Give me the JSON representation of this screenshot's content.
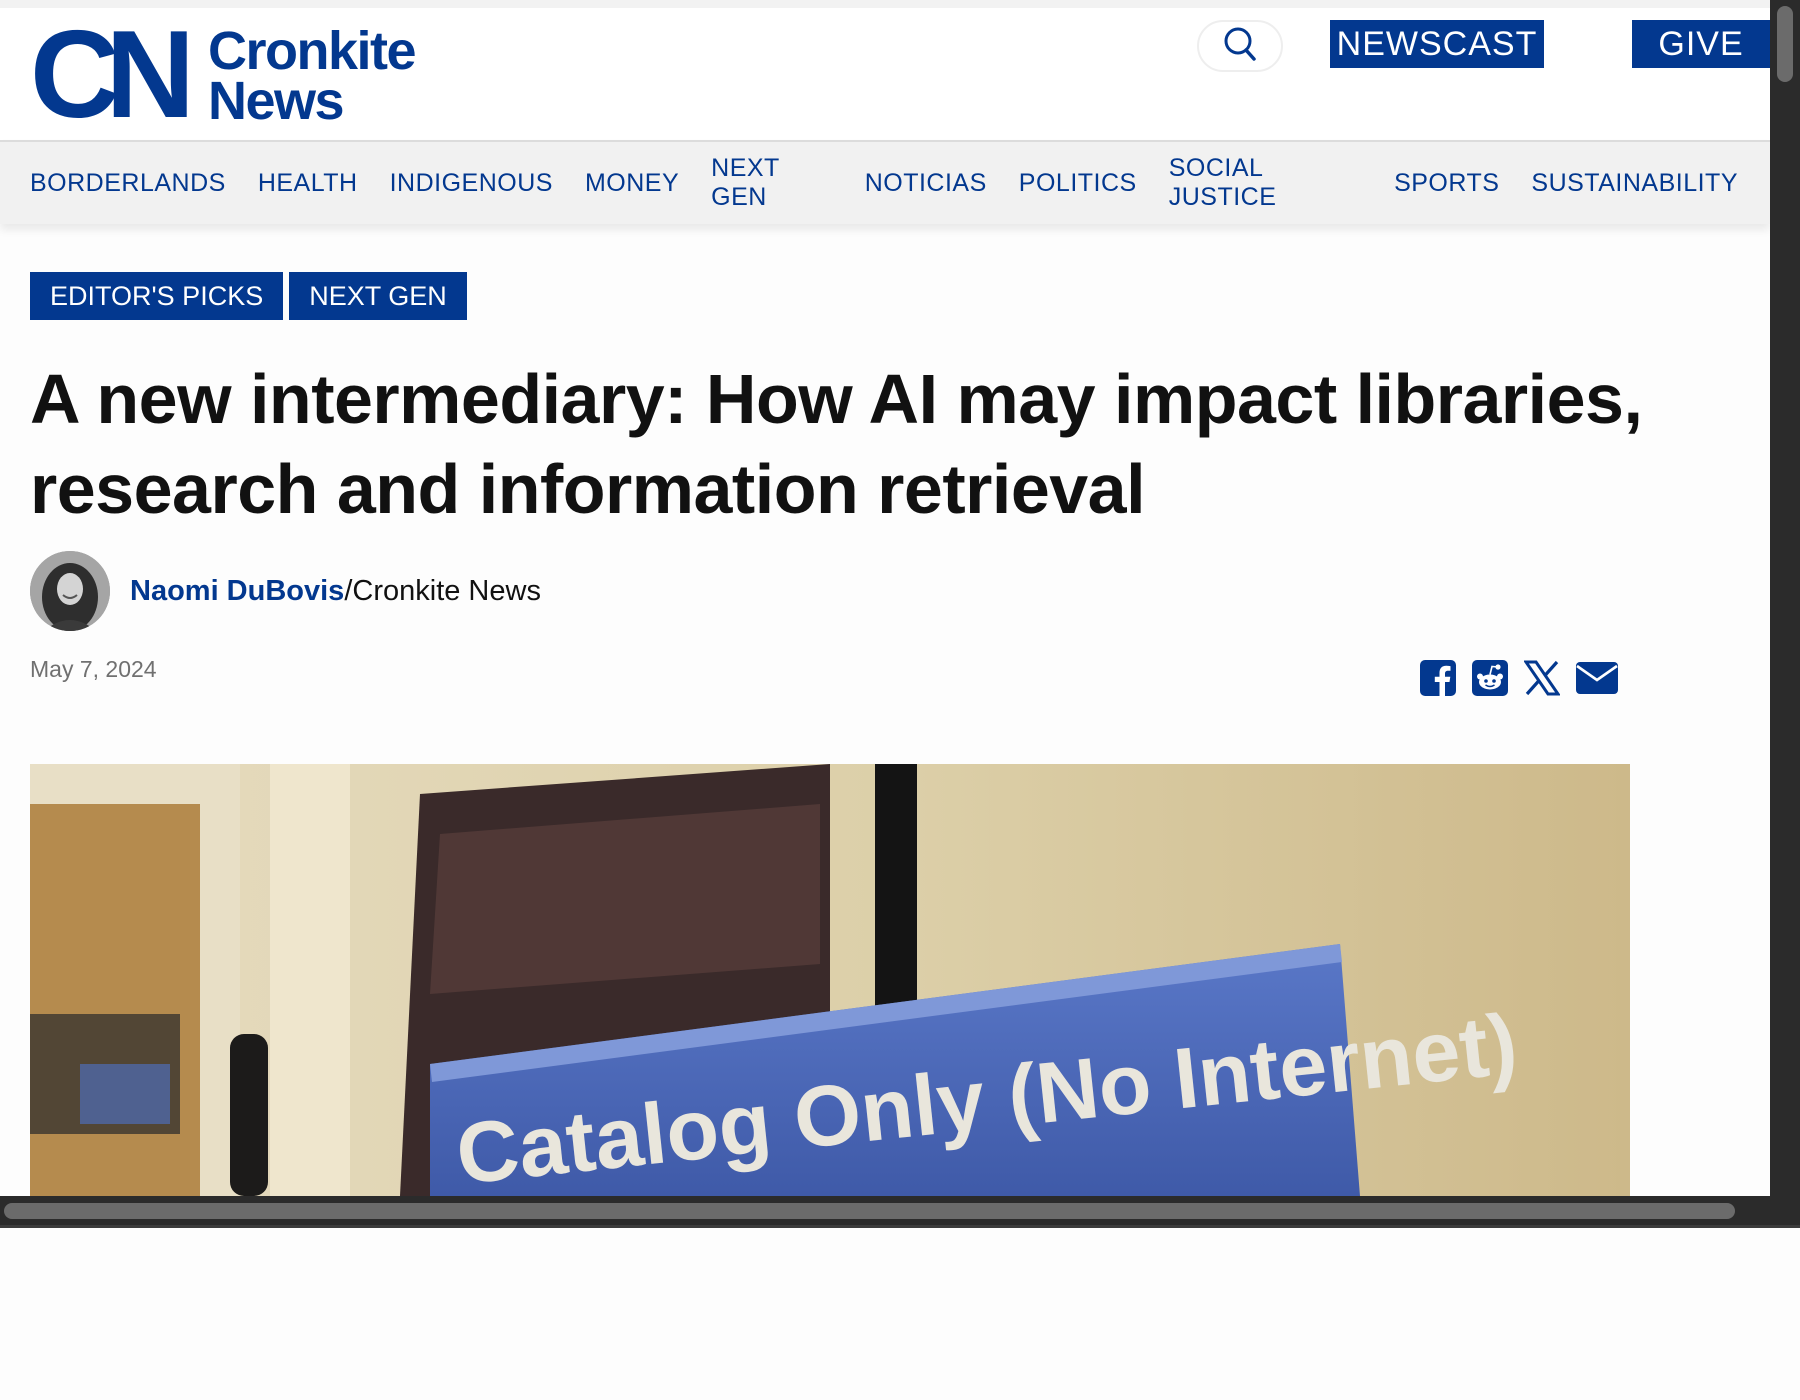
{
  "brand": {
    "logo_mark": "CN",
    "logo_line1": "Cronkite",
    "logo_line2": "News",
    "primary_color": "#03388f"
  },
  "header": {
    "search_icon": "search-icon",
    "newscast_label": "NEWSCAST",
    "give_label": "GIVE"
  },
  "nav": {
    "items": [
      {
        "label": "BORDERLANDS"
      },
      {
        "label": "HEALTH"
      },
      {
        "label": "INDIGENOUS"
      },
      {
        "label": "MONEY"
      },
      {
        "label": "NEXT GEN"
      },
      {
        "label": "NOTICIAS"
      },
      {
        "label": "POLITICS"
      },
      {
        "label": "SOCIAL JUSTICE"
      },
      {
        "label": "SPORTS"
      },
      {
        "label": "SUSTAINABILITY"
      }
    ]
  },
  "article": {
    "tags": [
      {
        "label": "EDITOR'S PICKS"
      },
      {
        "label": "NEXT GEN"
      }
    ],
    "title": "A new intermediary: How AI may impact libraries, research and information retrieval",
    "author": "Naomi DuBovis",
    "byline_separator": "/",
    "outlet": "Cronkite News",
    "date": "May 7, 2024",
    "share_icons": [
      "facebook-icon",
      "reddit-icon",
      "x-icon",
      "email-icon"
    ],
    "hero_image_sign_text": "Catalog Only (No Internet)"
  }
}
